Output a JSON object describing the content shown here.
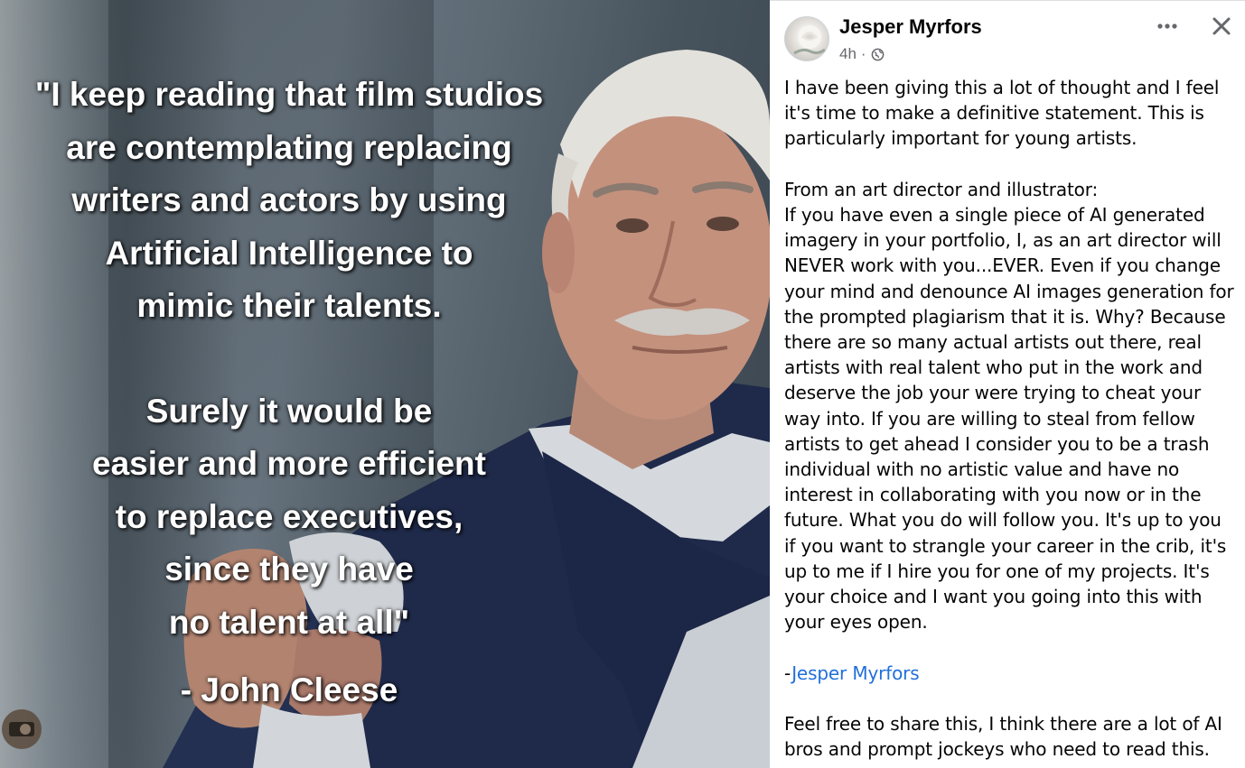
{
  "meme": {
    "quote_lines_1": [
      "\"I keep reading that film studios",
      "are contemplating replacing",
      "writers and actors by using",
      "Artificial Intelligence to",
      "mimic their talents."
    ],
    "quote_lines_2": [
      "Surely it would be",
      "easier and more efficient",
      "to replace executives,",
      "since they have",
      "no talent at all\""
    ],
    "attribution": "- John Cleese"
  },
  "post": {
    "author": "Jesper Myrfors",
    "timestamp": "4h",
    "separator": "·",
    "privacy_icon": "globe-icon",
    "more_icon": "more-horizontal-icon",
    "close_icon": "close-icon",
    "paragraph_1": "I have been giving this a lot of thought and I feel it's time to make a definitive statement. This is particularly important for young artists.",
    "paragraph_2_intro": "From an art director and illustrator:",
    "paragraph_2": "If you have even a single piece of AI generated imagery in your portfolio, I, as an art director will NEVER work with you...EVER. Even if you change your mind and denounce AI images generation for the prompted plagiarism that it is. Why? Because there are so many actual artists out there, real artists with real talent who put in the work and deserve the job your were trying to cheat your way into. If you are willing to steal from fellow artists to get ahead I consider you to be a trash individual with no artistic value and have no interest in collaborating with you now or in the future. What you do will follow you. It's up to you if you want to strangle your career in the crib, it's up to me if I hire you for one of my projects. It's your choice and I want you going into this with your eyes open.",
    "signature_prefix": "-",
    "signature_name": "Jesper Myrfors",
    "paragraph_3": "Feel free to share this, I think there are a lot of AI bros and prompt jockeys who need to read this."
  },
  "colors": {
    "link": "#216fdb",
    "meta": "#65676b",
    "text": "#050505"
  }
}
